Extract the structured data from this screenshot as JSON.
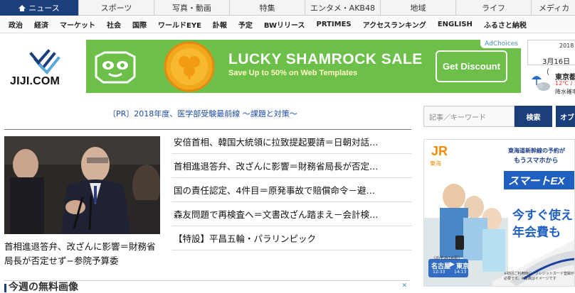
{
  "nav_primary": [
    {
      "label": "ニュース",
      "active": true,
      "width": 111
    },
    {
      "label": "スポーツ",
      "active": false,
      "width": 106
    },
    {
      "label": "写真・動画",
      "active": false,
      "width": 106
    },
    {
      "label": "特集",
      "active": false,
      "width": 106
    },
    {
      "label": "エンタメ・AKB48",
      "active": false,
      "width": 106
    },
    {
      "label": "地域",
      "active": false,
      "width": 106
    },
    {
      "label": "ライフ",
      "active": false,
      "width": 106
    },
    {
      "label": "メディカ",
      "active": false,
      "width": 61
    }
  ],
  "nav_secondary": [
    "政治",
    "経済",
    "マーケット",
    "社会",
    "国際",
    "ワールドEYE",
    "訃報",
    "予定",
    "BWリリース",
    "PRTIMES",
    "アクセスランキング",
    "ENGLISH",
    "ふるさと納税"
  ],
  "logo": {
    "text": "JIJI.COM"
  },
  "ad": {
    "choices_label": "AdChoices",
    "title": "LUCKY SHAMROCK SALE",
    "subtitle": "Save Up to 50% on Web Templates",
    "cta": "Get Discount",
    "bg_color": "#6cc04a"
  },
  "date": {
    "year": "2018",
    "day": "3月16日（"
  },
  "weather": {
    "city": "東京都",
    "temp": "12℃ / 5",
    "rain": "降水確率"
  },
  "pr_link": "〔PR〕2018年度、医学部受験最前線 ～課題と対策～",
  "feature": {
    "caption": "首相進退答弁、改ざんに影響＝財務省局長が否定せず−参院予算委"
  },
  "headlines": [
    "安倍首相、韓国大統領に拉致提起要請＝日朝対話…",
    "首相進退答弁、改ざんに影響＝財務省局長が否定…",
    "国の責任認定、4件目＝原発事故で賠償命令－避…",
    "森友問題で再検査へ＝文書改ざん踏まえ－会計検…",
    "【特設】平昌五輪・パラリンピック"
  ],
  "section": {
    "title": "今週の無料画像",
    "close_label": "✕"
  },
  "search": {
    "placeholder": "記事／キーワード",
    "button": "検索",
    "button2": "オブ"
  },
  "jr_ad": {
    "brand": "JR",
    "brand_sub": "東海",
    "line1": "東海道新幹線の予約が",
    "line2": "もうスマホから",
    "logo_text": "スマートEX",
    "pitch1": "今すぐ使え",
    "pitch2": "年会費も",
    "route_from": "名古屋",
    "route_to": "東京",
    "time_from": "12:33",
    "time_to": "14:13",
    "route_note": "〈のぞみ16号〉",
    "fineprint": "※初回ご利用時に、クレジットカード登録が必要です。※写真はイメージです"
  }
}
